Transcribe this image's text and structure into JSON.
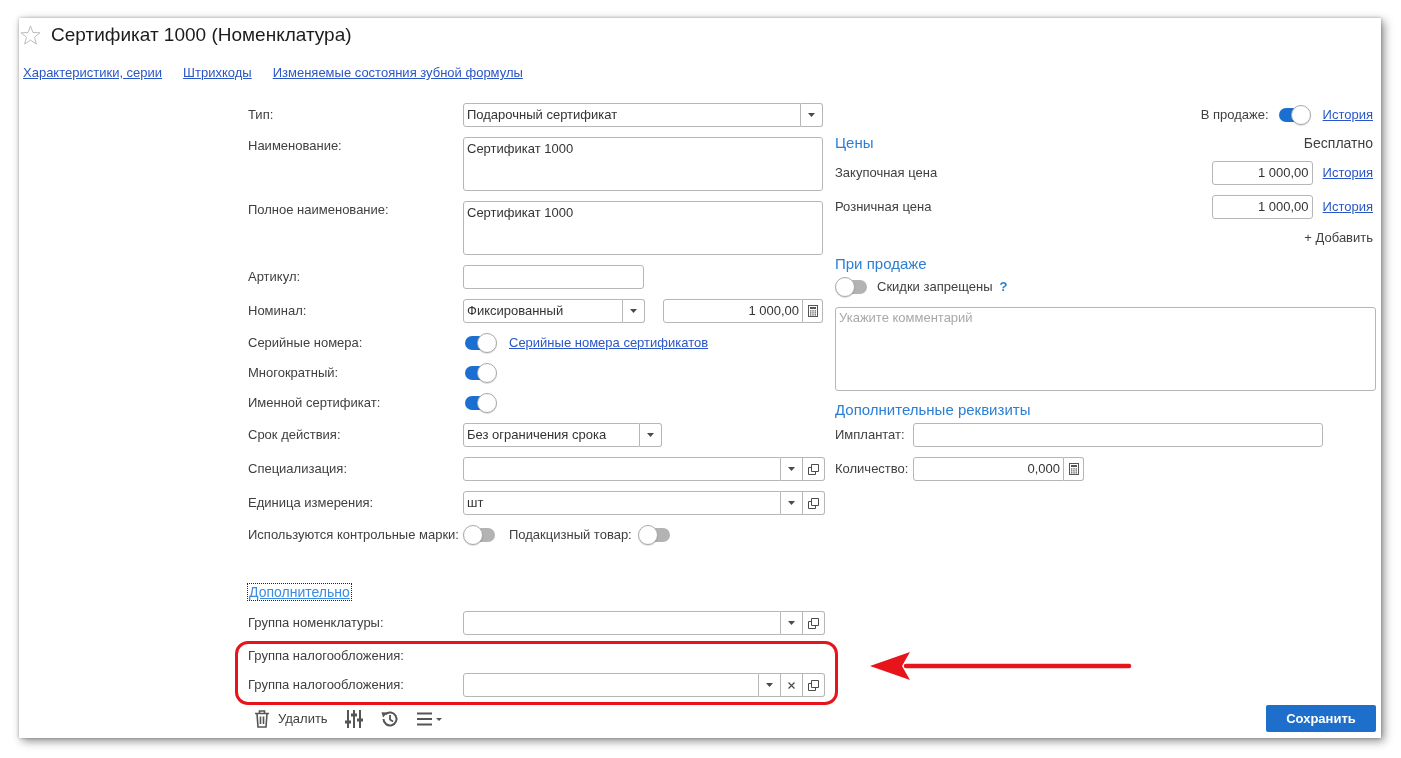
{
  "window": {
    "title": "Сертификат 1000 (Номенклатура)",
    "favorite": false
  },
  "links": [
    {
      "label": "Характеристики, серии"
    },
    {
      "label": "Штрихкоды"
    },
    {
      "label": "Изменяемые состояния зубной формулы"
    }
  ],
  "main_fields": [
    {
      "kind": "select",
      "label": "Тип:",
      "value": "Подарочный сертификат"
    },
    {
      "kind": "memo",
      "label": "Наименование:",
      "value": "Сертификат 1000"
    },
    {
      "kind": "memo",
      "label": "Полное наименование:",
      "value": "Сертификат 1000"
    },
    {
      "kind": "text",
      "label": "Артикул:"
    },
    {
      "kind": "nominal",
      "label": "Номинал:",
      "value": "Фиксированный",
      "amount": "1 000,00"
    },
    {
      "kind": "switch",
      "label": "Серийные номера:",
      "on": true,
      "link": "Серийные номера сертификатов"
    },
    {
      "kind": "switch",
      "label": "Многократный:",
      "on": true
    },
    {
      "kind": "switch",
      "label": "Именной сертификат:",
      "on": true
    },
    {
      "kind": "choice",
      "label": "Срок действия:",
      "value": "Без ограничения срока"
    },
    {
      "kind": "reference",
      "label": "Специализация:"
    },
    {
      "kind": "reference",
      "label": "Единица измерения:",
      "value": "шт"
    },
    {
      "kind": "pair",
      "items": [
        {
          "label": "Используются контрольные марки:",
          "on": false
        },
        {
          "label": "Подакцизный товар:",
          "on": false
        }
      ]
    }
  ],
  "more": {
    "label": "Дополнительно",
    "focused": true,
    "fields": [
      {
        "kind": "reference",
        "label": "Группа номенклатуры:"
      }
    ],
    "tax_group": {
      "highlighted": true,
      "caption": "Группа налогообложения:",
      "field": {
        "kind": "clearable",
        "label": "Группа налогообложения:"
      }
    }
  },
  "on_sale": {
    "label": "В продаже:",
    "on": true,
    "history": "История"
  },
  "prices": {
    "title": "Цены",
    "summary": "Бесплатно",
    "rows": [
      {
        "label": "Закупочная цена",
        "value": "1 000,00",
        "history": "История"
      },
      {
        "label": "Розничная цена",
        "value": "1 000,00",
        "history": "История"
      }
    ],
    "add": "+ Добавить"
  },
  "on_selling": {
    "title": "При продаже",
    "discounts": {
      "label": "Скидки запрещены",
      "on": false,
      "help": "?"
    },
    "comment": {
      "placeholder": "Укажите комментарий"
    }
  },
  "extra_props": {
    "title": "Дополнительные реквизиты",
    "fields": [
      {
        "kind": "text",
        "label": "Имплантат:"
      },
      {
        "kind": "number",
        "label": "Количество:",
        "value": "0,000"
      }
    ]
  },
  "toolbar": {
    "delete": "Удалить",
    "save": "Сохранить"
  }
}
